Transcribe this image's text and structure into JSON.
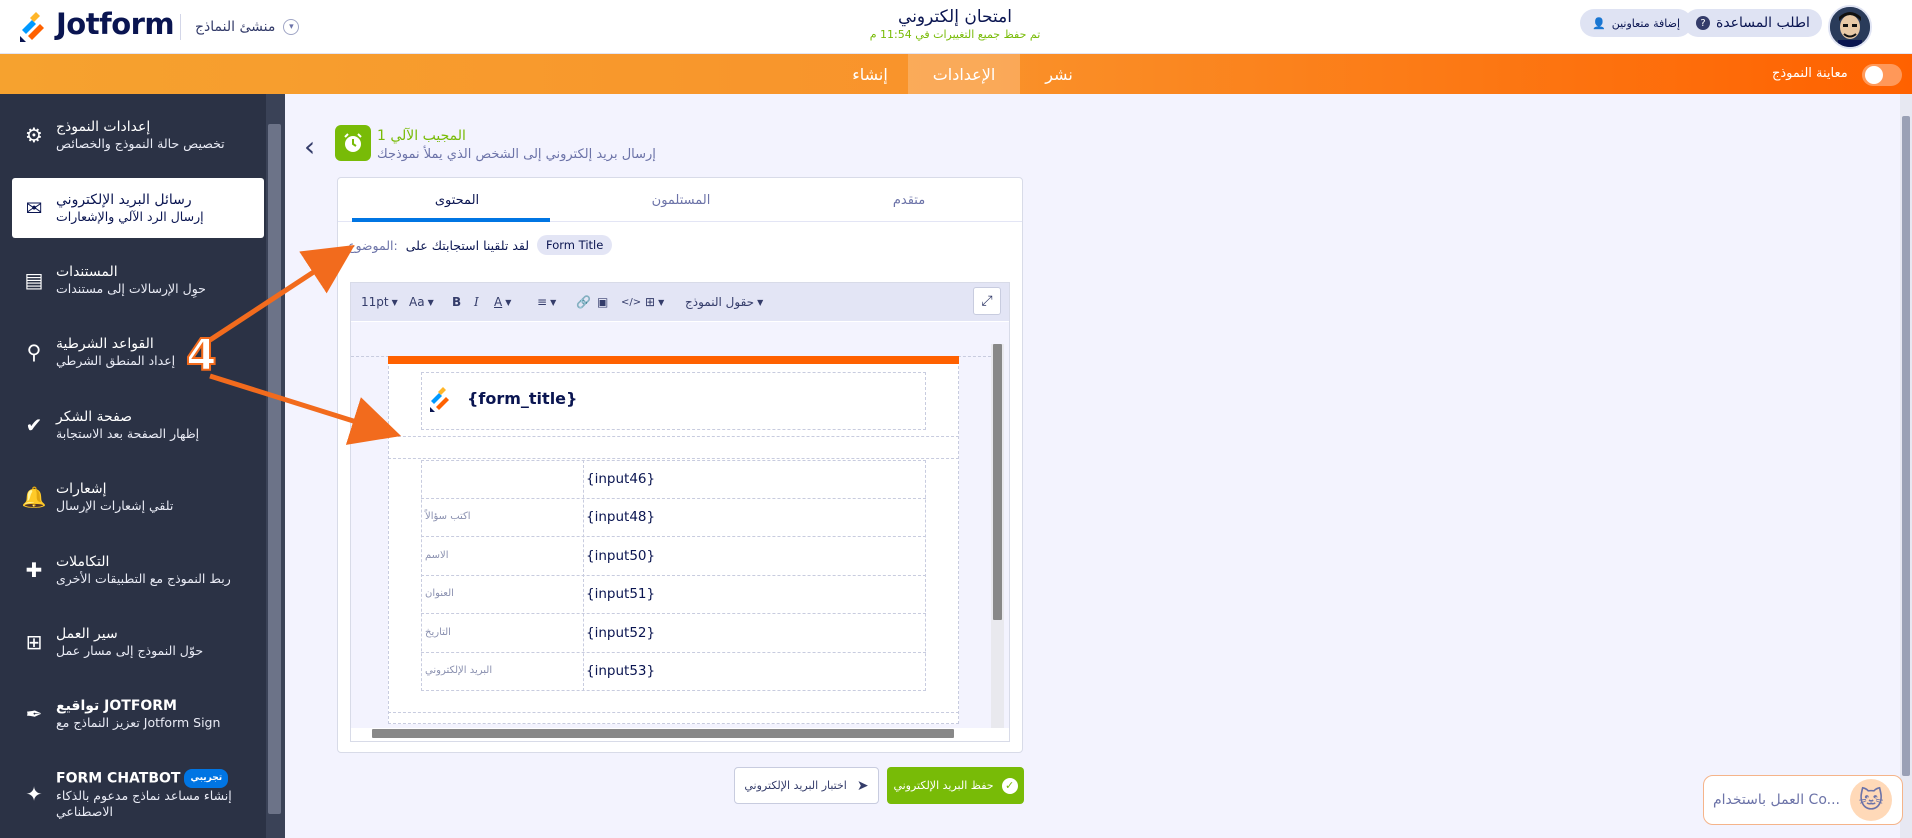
{
  "app": {
    "brand": "Jotform",
    "builder_label": "منشئ النماذج"
  },
  "header": {
    "form_title": "امتحان إلكتروني",
    "save_status": "تم حفظ جميع التغييرات في 11:54 م",
    "help_label": "اطلب المساعدة",
    "collab_label": "إضافة متعاونين"
  },
  "navbar": {
    "tabs": [
      {
        "label": "إنشاء"
      },
      {
        "label": "الإعدادات"
      },
      {
        "label": "نشر"
      }
    ],
    "active_tab": "الإعدادات",
    "preview_label": "معاينة النموذج",
    "preview_on": false
  },
  "sidebar": {
    "items": [
      {
        "title": "إعدادات النموذج",
        "subtitle": "تخصيص حالة النموذج والخصائص",
        "icon": "gear-icon"
      },
      {
        "title": "رسائل البريد الإلكتروني",
        "subtitle": "إرسال الرد الآلي والإشعارات",
        "icon": "envelope-icon"
      },
      {
        "title": "المستندات",
        "subtitle": "حوِل الإرسالات إلى مستندات",
        "icon": "document-icon"
      },
      {
        "title": "القواعد الشرطية",
        "subtitle": "إعداد المنطق الشرطي",
        "icon": "sitemap-icon"
      },
      {
        "title": "صفحة الشكر",
        "subtitle": "إظهار الصفحة بعد الاستجابة",
        "icon": "check-circle-icon"
      },
      {
        "title": "إشعارات",
        "subtitle": "تلقي إشعارات الإرسال",
        "icon": "bell-icon"
      },
      {
        "title": "التكاملات",
        "subtitle": "ربط النموذج مع التطبيقات الأخرى",
        "icon": "puzzle-icon"
      },
      {
        "title": "سير العمل",
        "subtitle": "حوّل النموذج إلى مسار عمل",
        "icon": "workflow-icon"
      },
      {
        "title": "تواقيع JOTFORM",
        "subtitle": "تعزيز النماذج مع Jotform Sign",
        "icon": "pen-icon"
      },
      {
        "title": "FORM CHATBOT",
        "subtitle": "إنشاء مساعد نماذج مدعوم بالذكاء الاصطناعي",
        "icon": "chatbot-icon",
        "badge": "تجريبي"
      }
    ],
    "active_index": 1
  },
  "autoresponder": {
    "title": "المجيب الآلي 1",
    "description": "إرسال بريد إلكتروني إلى الشخص الذي يملأ نموذجك"
  },
  "tabs": {
    "content": "المحتوى",
    "recipients": "المستلمون",
    "advanced": "متقدم"
  },
  "subject": {
    "label": "الموضوع:",
    "text": "لقد تلقينا استجابتك على",
    "chip": "Form Title"
  },
  "toolbar": {
    "font_size": "11pt",
    "text_case": "Aa",
    "bold": "B",
    "italic": "I",
    "color": "A",
    "form_fields": "حقول النموذج"
  },
  "email": {
    "form_title_tag": "{form_title}",
    "rows": [
      {
        "label": "",
        "value": "{input46}"
      },
      {
        "label": "اكتب سؤالاً",
        "value": "{input48}"
      },
      {
        "label": "الاسم",
        "value": "{input50}"
      },
      {
        "label": "العنوان",
        "value": "{input51}"
      },
      {
        "label": "التاريخ",
        "value": "{input52}"
      },
      {
        "label": "البريد الإلكتروني",
        "value": "{input53}"
      }
    ]
  },
  "buttons": {
    "test": "اختبار البريد الإلكتروني",
    "save": "حفظ البريد الإلكتروني"
  },
  "annotation": {
    "number": "4"
  },
  "chat_widget": {
    "label": "العمل باستخدام Co..."
  },
  "colors": {
    "brand_orange": "#ff6100",
    "accent_green": "#78bb07",
    "sidebar_bg": "#2b3245",
    "link_blue": "#0075e3"
  }
}
